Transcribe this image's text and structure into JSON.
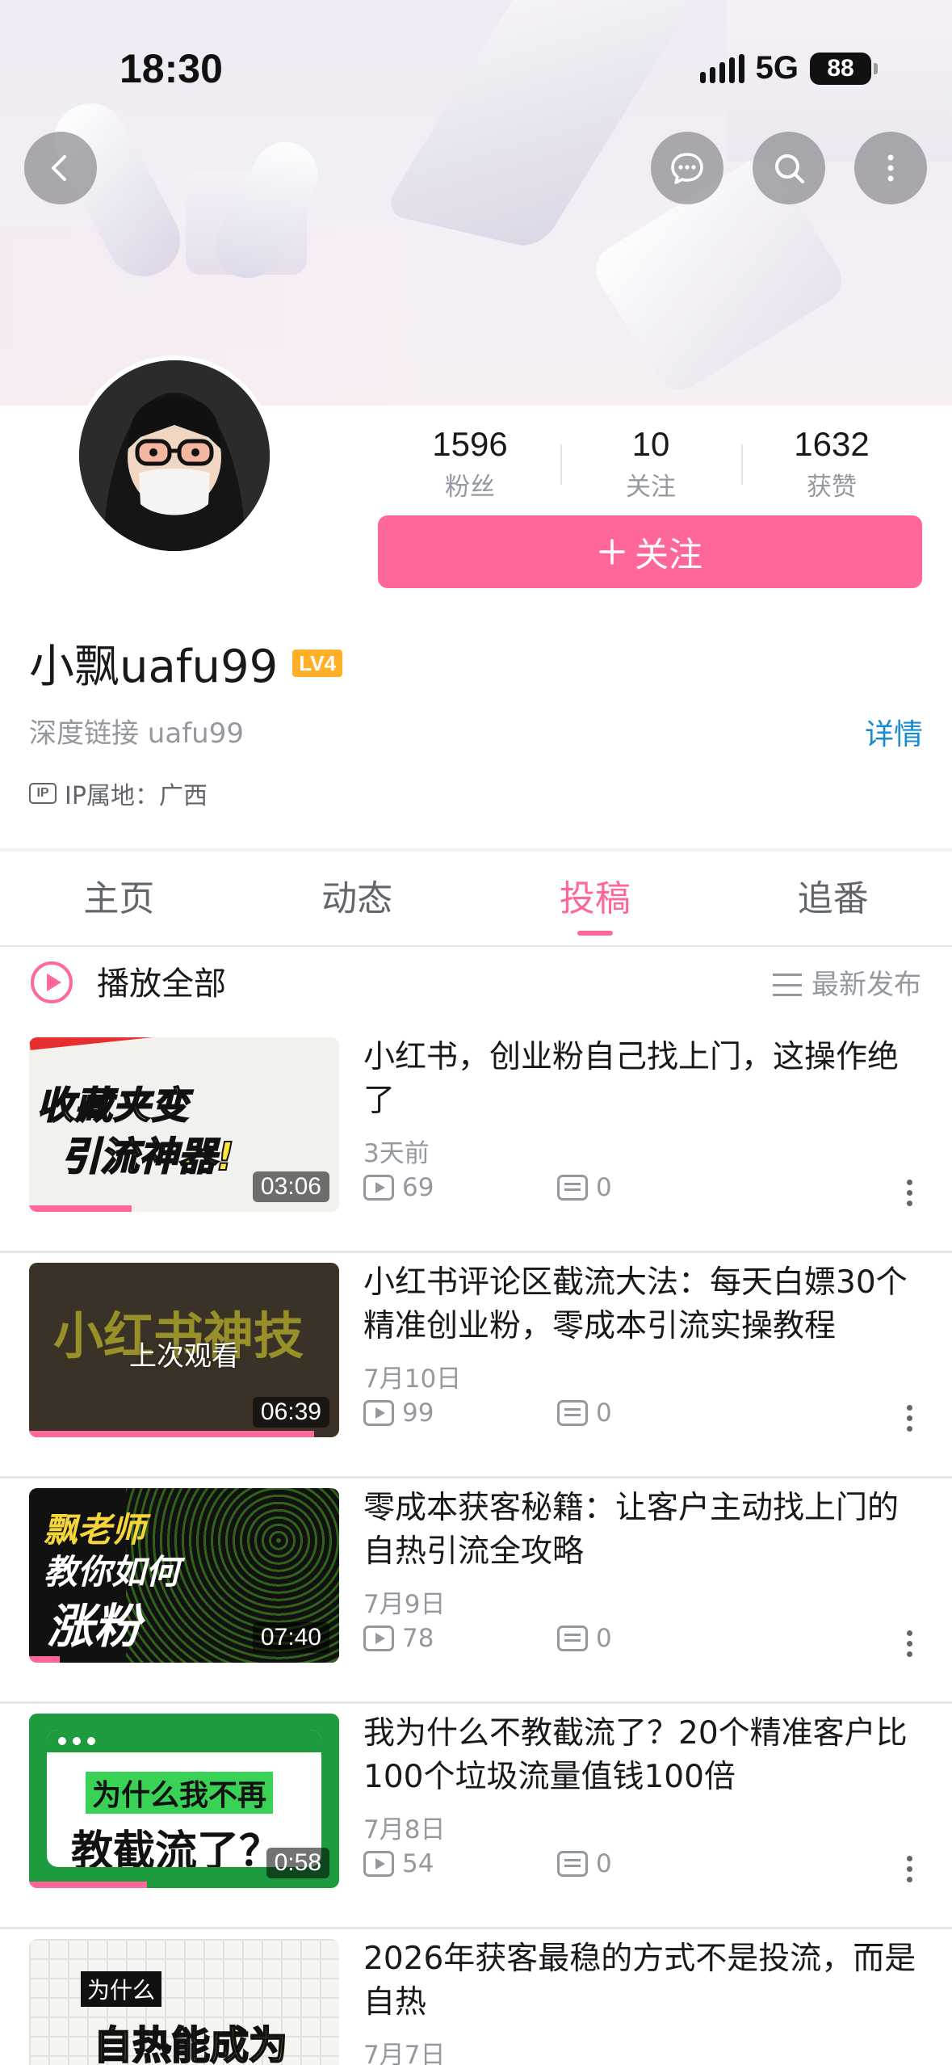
{
  "status_bar": {
    "time": "18:30",
    "network": "5G",
    "battery": "88"
  },
  "profile": {
    "stats": [
      {
        "value": "1596",
        "label": "粉丝"
      },
      {
        "value": "10",
        "label": "关注"
      },
      {
        "value": "1632",
        "label": "获赞"
      }
    ],
    "follow_label": "关注",
    "name": "小飘uafu99",
    "level": "LV4",
    "signature": "深度链接 uafu99",
    "detail_link": "详情",
    "ip_badge": "IP",
    "ip_location": "IP属地：广西"
  },
  "tabs": [
    {
      "label": "主页",
      "active": false
    },
    {
      "label": "动态",
      "active": false
    },
    {
      "label": "投稿",
      "active": true
    },
    {
      "label": "追番",
      "active": false
    }
  ],
  "list_header": {
    "play_all": "播放全部",
    "sort": "最新发布"
  },
  "videos": [
    {
      "title": "小红书，创业粉自己找上门，这操作绝了",
      "date": "3天前",
      "views": "69",
      "comments": "0",
      "duration": "03:06",
      "thumb_text": [
        "收藏夹变",
        "引流神器!"
      ],
      "progress": 0.33
    },
    {
      "title": "小红书评论区截流大法：每天白嫖30个精准创业粉，零成本引流实操教程",
      "date": "7月10日",
      "views": "99",
      "comments": "0",
      "duration": "06:39",
      "thumb_text": [
        "小红书神技"
      ],
      "resume_label": "上次观看",
      "progress": 0.92
    },
    {
      "title": "零成本获客秘籍：让客户主动找上门的自热引流全攻略",
      "date": "7月9日",
      "views": "78",
      "comments": "0",
      "duration": "07:40",
      "thumb_text": [
        "飘老师",
        "教你如何",
        "涨粉"
      ],
      "progress": 0.1
    },
    {
      "title": "我为什么不教截流了？20个精准客户比100个垃圾流量值钱100倍",
      "date": "7月8日",
      "views": "54",
      "comments": "0",
      "duration": "0:58",
      "thumb_text": [
        "为什么我不再",
        "教截流了？"
      ],
      "progress": 0.38
    },
    {
      "title": "2026年获客最稳的方式不是投流，而是自热",
      "date": "7月7日",
      "thumb_text": [
        "为什么",
        "自热能成为"
      ]
    }
  ]
}
